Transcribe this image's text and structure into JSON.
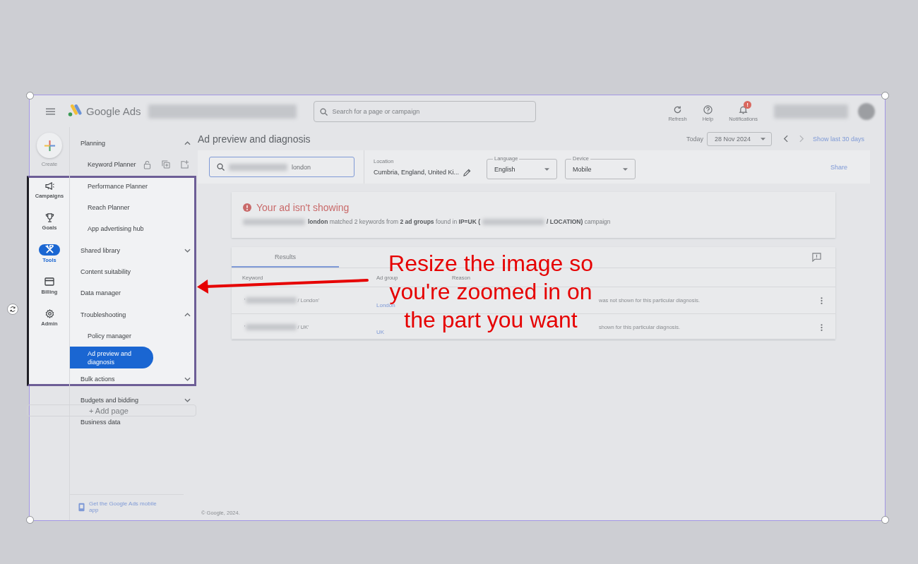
{
  "canvas": {
    "annotation": [
      "Resize the image so",
      "you're zoomed in on",
      "the part you want"
    ],
    "add_page": "+ Add page"
  },
  "topbar": {
    "product": "Google Ads",
    "search_placeholder": "Search for a page or campaign",
    "actions": [
      {
        "kind": "refresh",
        "label": "Refresh"
      },
      {
        "kind": "help",
        "label": "Help"
      },
      {
        "kind": "notifications",
        "label": "Notifications",
        "badge": "!"
      }
    ]
  },
  "rail": {
    "create": "Create",
    "items": [
      {
        "kind": "campaigns",
        "label": "Campaigns",
        "selected": false
      },
      {
        "kind": "goals",
        "label": "Goals",
        "selected": false
      },
      {
        "kind": "tools",
        "label": "Tools",
        "selected": true
      },
      {
        "kind": "billing",
        "label": "Billing",
        "selected": false
      },
      {
        "kind": "admin",
        "label": "Admin",
        "selected": false
      }
    ]
  },
  "nav": [
    {
      "kind": "group",
      "label": "Planning",
      "expanded": true,
      "children": [
        {
          "label": "Keyword Planner",
          "selected": false,
          "hover_actions": true
        },
        {
          "label": "Performance Planner",
          "selected": false,
          "hover_actions": false
        },
        {
          "label": "Reach Planner",
          "selected": false,
          "hover_actions": false
        },
        {
          "label": "App advertising hub",
          "selected": false,
          "hover_actions": false
        }
      ]
    },
    {
      "kind": "group",
      "label": "Shared library",
      "expanded": false
    },
    {
      "kind": "link",
      "label": "Content suitability",
      "selected": false
    },
    {
      "kind": "link",
      "label": "Data manager",
      "selected": false
    },
    {
      "kind": "group",
      "label": "Troubleshooting",
      "expanded": true,
      "children": [
        {
          "label": "Policy manager",
          "selected": false,
          "hover_actions": false
        },
        {
          "label": "Ad preview and diagnosis",
          "selected": true,
          "hover_actions": false
        }
      ]
    },
    {
      "kind": "group",
      "label": "Bulk actions",
      "expanded": false
    },
    {
      "kind": "group",
      "label": "Budgets and bidding",
      "expanded": false
    },
    {
      "kind": "link",
      "label": "Business data",
      "selected": false
    }
  ],
  "mobile_app": "Get the Google Ads mobile app",
  "page": {
    "title": "Ad preview and diagnosis",
    "today_label": "Today",
    "date": "28 Nov 2024",
    "range_link": "Show last 30 days",
    "query": "london",
    "location_label": "Location",
    "location": "Cumbria, England, United Ki...",
    "language_label": "Language",
    "language": "English",
    "device_label": "Device",
    "device": "Mobile",
    "share": "Share"
  },
  "alert": {
    "title": "Your ad isn't showing",
    "message_start": "**london** matched 2 keywords from **2 ad groups** found in **IP=UK (**",
    "message_end": "**/ LOCATION)** campaign"
  },
  "results": {
    "tabs": [
      {
        "label": "Results",
        "selected": true
      }
    ],
    "columns": [
      "Keyword",
      "Ad group",
      "Reason"
    ],
    "rows": [
      {
        "keyword_start": "'",
        "keyword_end": "/ London'",
        "ad_group": "London",
        "reason": "was not shown for this particular diagnosis."
      },
      {
        "keyword_start": "'",
        "keyword_end": "/ UK'",
        "ad_group": "UK",
        "reason": "shown for this particular diagnosis."
      }
    ]
  },
  "footer": "© Google, 2024."
}
